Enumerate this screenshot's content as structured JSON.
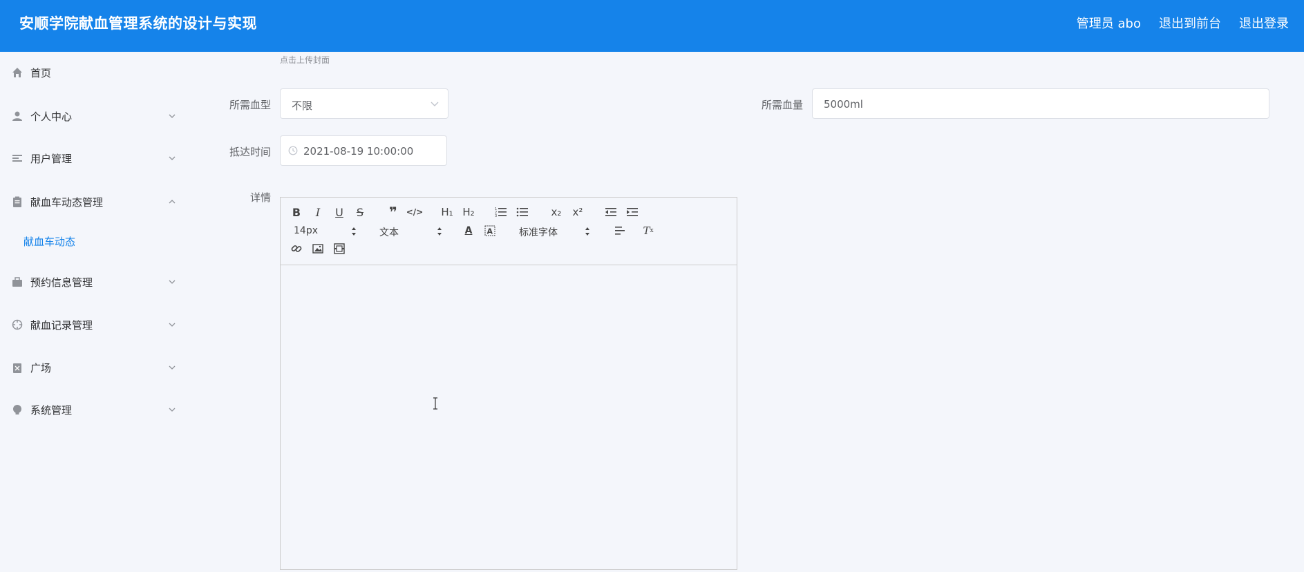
{
  "header": {
    "title": "安顺学院献血管理系统的设计与实现",
    "user": "管理员 abo",
    "to_front": "退出到前台",
    "logout": "退出登录"
  },
  "sidebar": {
    "items": [
      {
        "label": "首页",
        "icon": "home-icon",
        "has_arrow": false
      },
      {
        "label": "个人中心",
        "icon": "user-icon",
        "has_arrow": true
      },
      {
        "label": "用户管理",
        "icon": "list-icon",
        "has_arrow": true
      },
      {
        "label": "献血车动态管理",
        "icon": "clipboard-icon",
        "has_arrow": true,
        "expanded": true
      },
      {
        "label": "预约信息管理",
        "icon": "briefcase-icon",
        "has_arrow": true
      },
      {
        "label": "献血记录管理",
        "icon": "target-icon",
        "has_arrow": true
      },
      {
        "label": "广场",
        "icon": "flag-icon",
        "has_arrow": true
      },
      {
        "label": "系统管理",
        "icon": "bulb-icon",
        "has_arrow": true
      }
    ],
    "submenu": {
      "label": "献血车动态"
    }
  },
  "form": {
    "cover_hint": "点击上传封面",
    "blood_type": {
      "label": "所需血型",
      "value": "不限"
    },
    "blood_volume": {
      "label": "所需血量",
      "value": "5000ml"
    },
    "arrival_time": {
      "label": "抵达时间",
      "value": "2021-08-19 10:00:00"
    },
    "details": {
      "label": "详情"
    }
  },
  "editor": {
    "font_size": "14px",
    "header_select": "文本",
    "font_family": "标准字体"
  },
  "colors": {
    "accent": "#1583ea",
    "background": "#f4f6fb"
  }
}
